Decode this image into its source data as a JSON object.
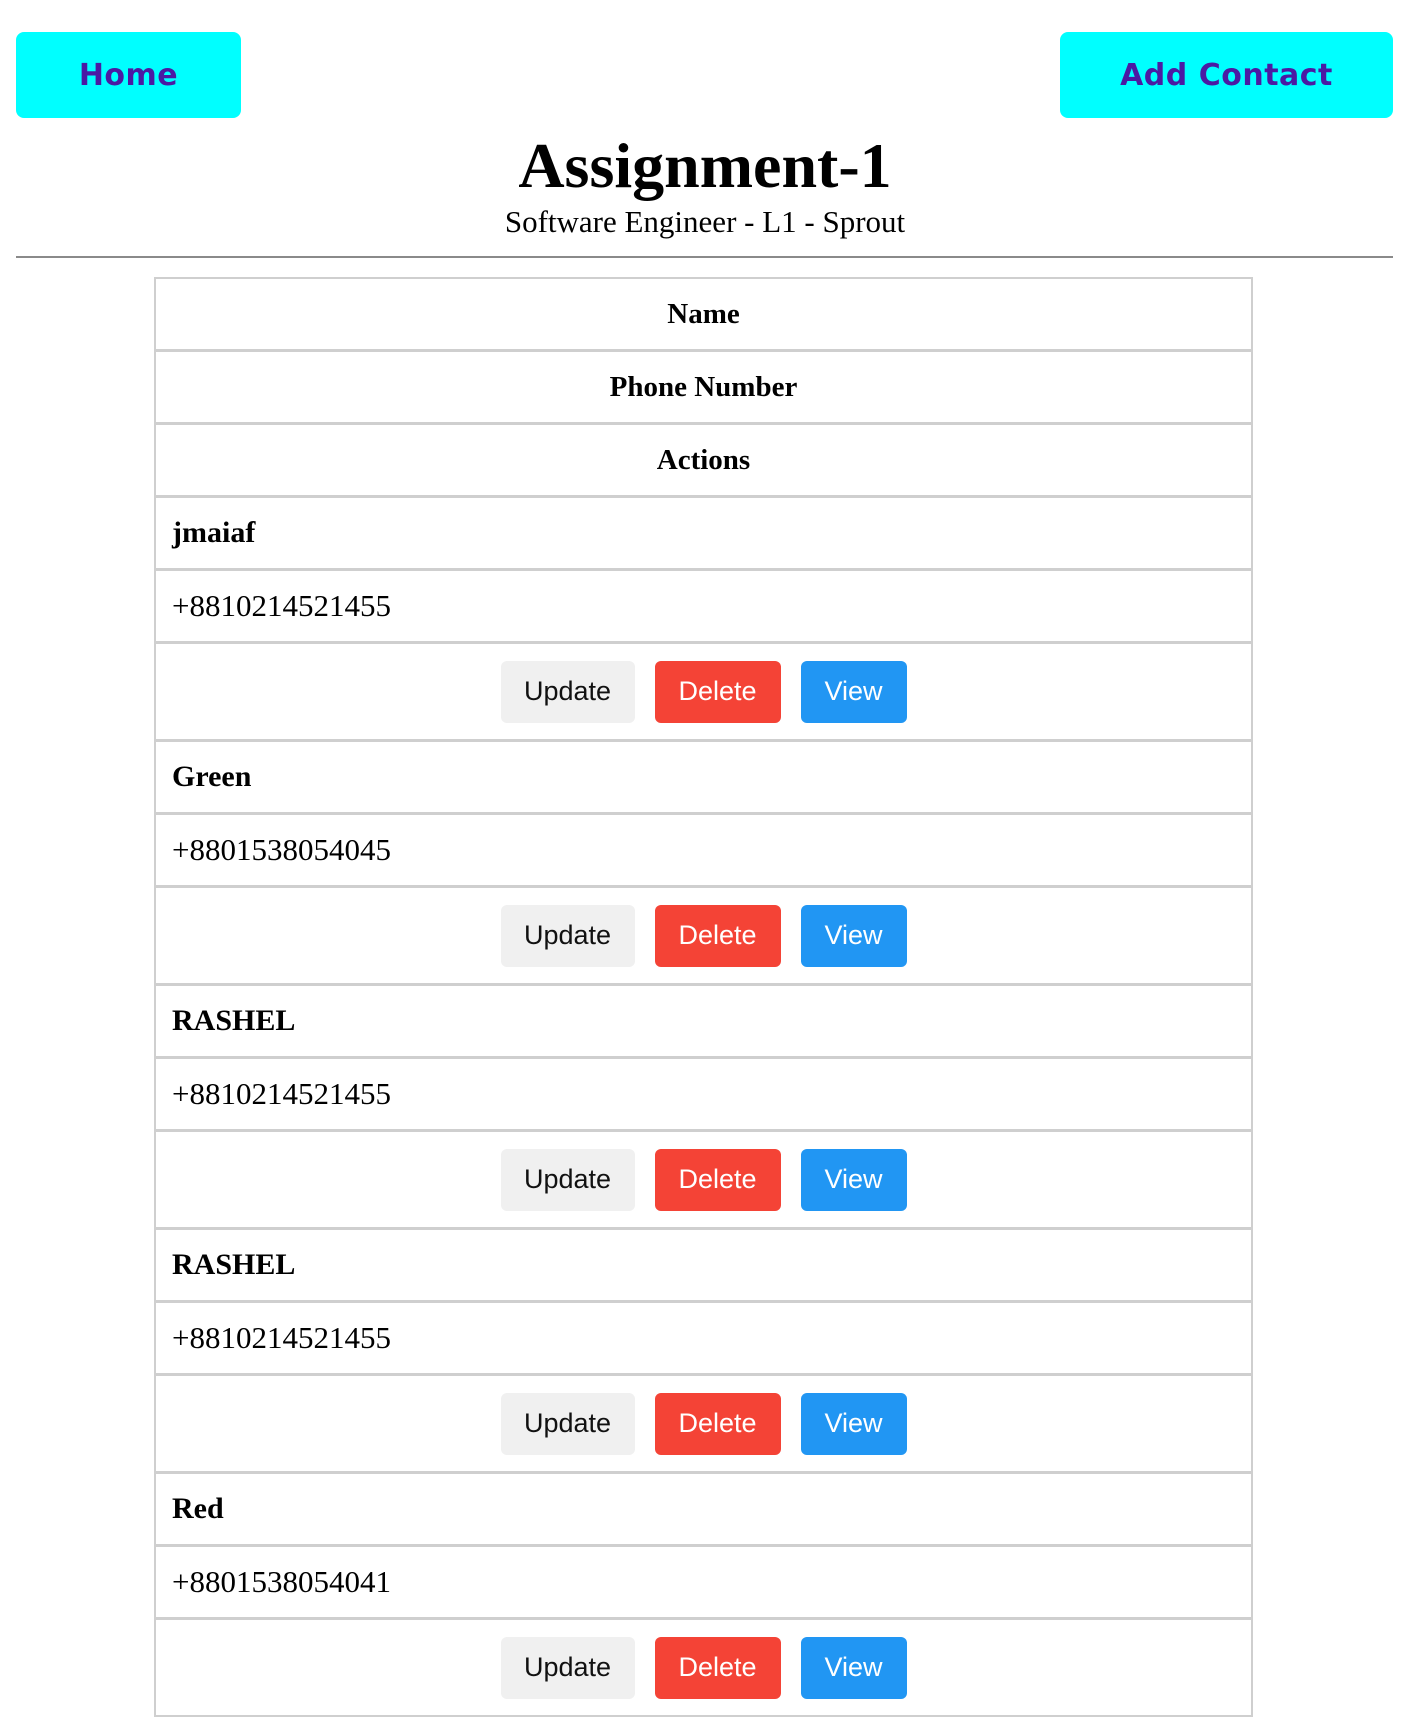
{
  "nav": {
    "home_label": "Home",
    "add_contact_label": "Add Contact"
  },
  "header": {
    "title": "Assignment-1",
    "subtitle": "Software Engineer - L1 - Sprout"
  },
  "table": {
    "headers": [
      "Name",
      "Phone Number",
      "Actions"
    ],
    "actions": {
      "update_label": "Update",
      "delete_label": "Delete",
      "view_label": "View"
    },
    "rows": [
      {
        "name": "jmaiaf",
        "phone": "+8810214521455"
      },
      {
        "name": "Green",
        "phone": "+8801538054045"
      },
      {
        "name": "RASHEL",
        "phone": "+8810214521455"
      },
      {
        "name": "RASHEL",
        "phone": "+8810214521455"
      },
      {
        "name": "Red",
        "phone": "+8801538054041"
      }
    ]
  },
  "colors": {
    "nav_button_bg": "#00ffff",
    "nav_button_text": "#4b1aa3",
    "update_bg": "#f0f0f0",
    "delete_bg": "#f44336",
    "view_bg": "#2196f3",
    "border": "#cfcfcf"
  }
}
